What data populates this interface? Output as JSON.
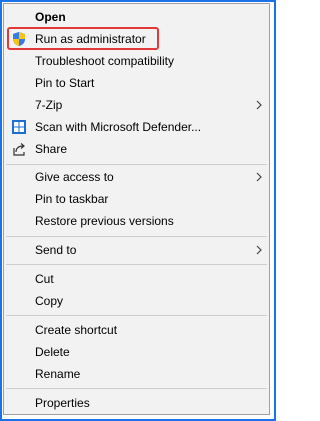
{
  "menu": {
    "items": [
      {
        "label": "Open"
      },
      {
        "label": "Run as administrator",
        "icon": "uac-shield-icon"
      },
      {
        "label": "Troubleshoot compatibility"
      },
      {
        "label": "Pin to Start"
      },
      {
        "label": "7-Zip",
        "submenu": true
      },
      {
        "label": "Scan with Microsoft Defender...",
        "icon": "defender-icon"
      },
      {
        "label": "Share",
        "icon": "share-icon"
      },
      {
        "label": "Give access to",
        "submenu": true
      },
      {
        "label": "Pin to taskbar"
      },
      {
        "label": "Restore previous versions"
      },
      {
        "label": "Send to",
        "submenu": true
      },
      {
        "label": "Cut"
      },
      {
        "label": "Copy"
      },
      {
        "label": "Create shortcut"
      },
      {
        "label": "Delete"
      },
      {
        "label": "Rename"
      },
      {
        "label": "Properties"
      }
    ]
  },
  "colors": {
    "frame_border": "#1a73e8",
    "highlight_box": "#e23838",
    "menu_background": "#f2f2f2",
    "separator": "#cfcfcf"
  }
}
